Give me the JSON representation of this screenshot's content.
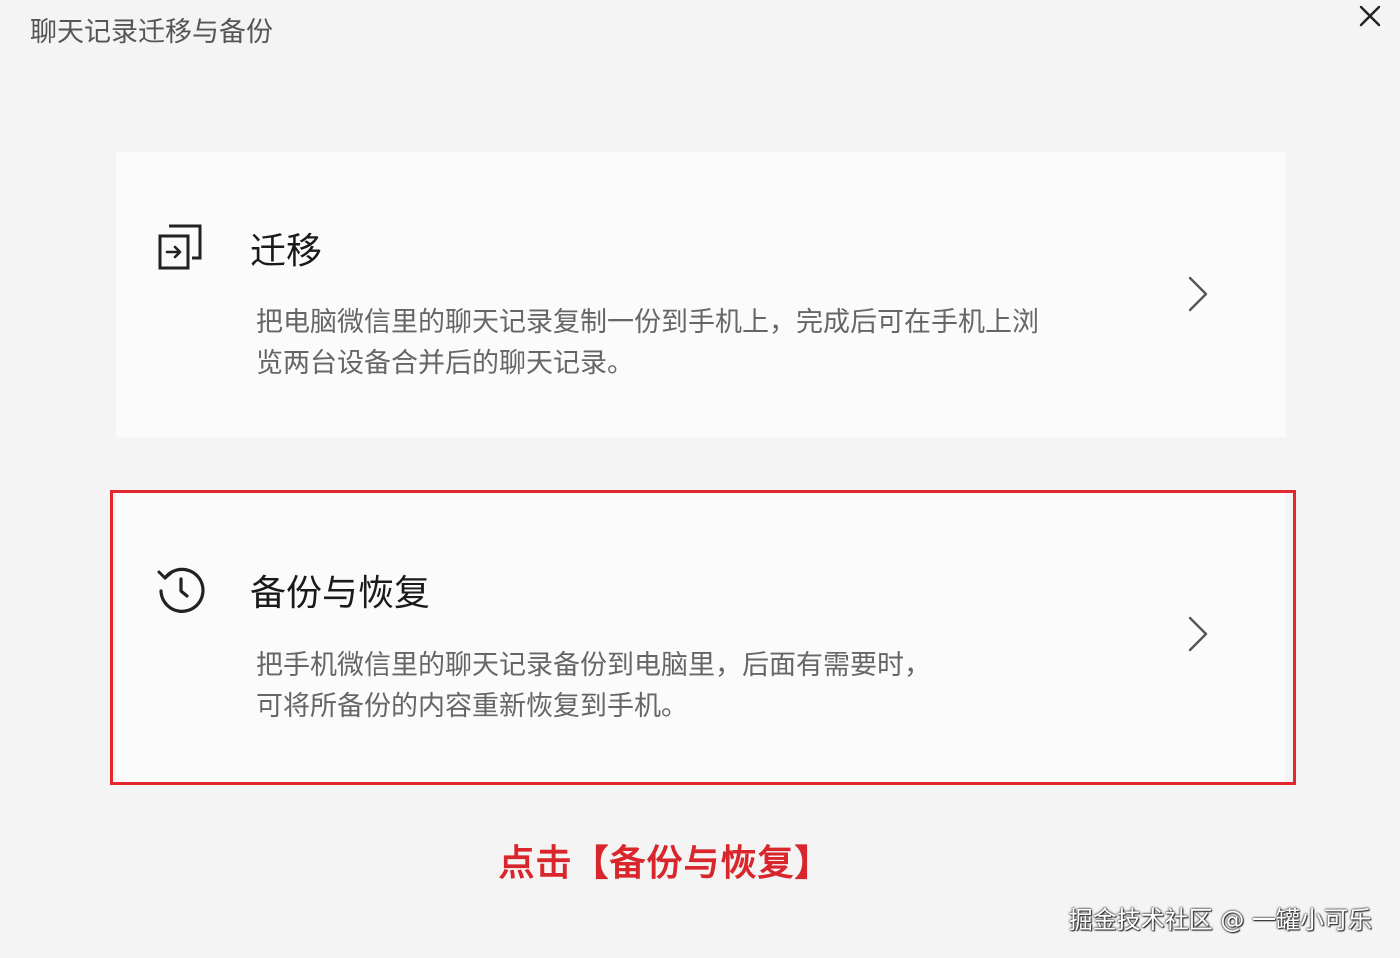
{
  "window": {
    "title": "聊天记录迁移与备份",
    "close_icon": "close-icon"
  },
  "cards": {
    "migrate": {
      "icon": "migrate-icon",
      "title": "迁移",
      "description_line1": "把电脑微信里的聊天记录复制一份到手机上，完成后可在手机上浏",
      "description_line2": "览两台设备合并后的聊天记录。",
      "chevron_icon": "chevron-right-icon"
    },
    "backup": {
      "icon": "history-clock-icon",
      "title": "备份与恢复",
      "description_line1": "把手机微信里的聊天记录备份到电脑里，后面有需要时，",
      "description_line2": "可将所备份的内容重新恢复到手机。",
      "chevron_icon": "chevron-right-icon",
      "highlight_color": "#e0282e"
    }
  },
  "annotation": {
    "instruction": "点击【备份与恢复】",
    "color": "#d8262c"
  },
  "watermark": {
    "text": "掘金技术社区 @ 一罐小可乐"
  }
}
